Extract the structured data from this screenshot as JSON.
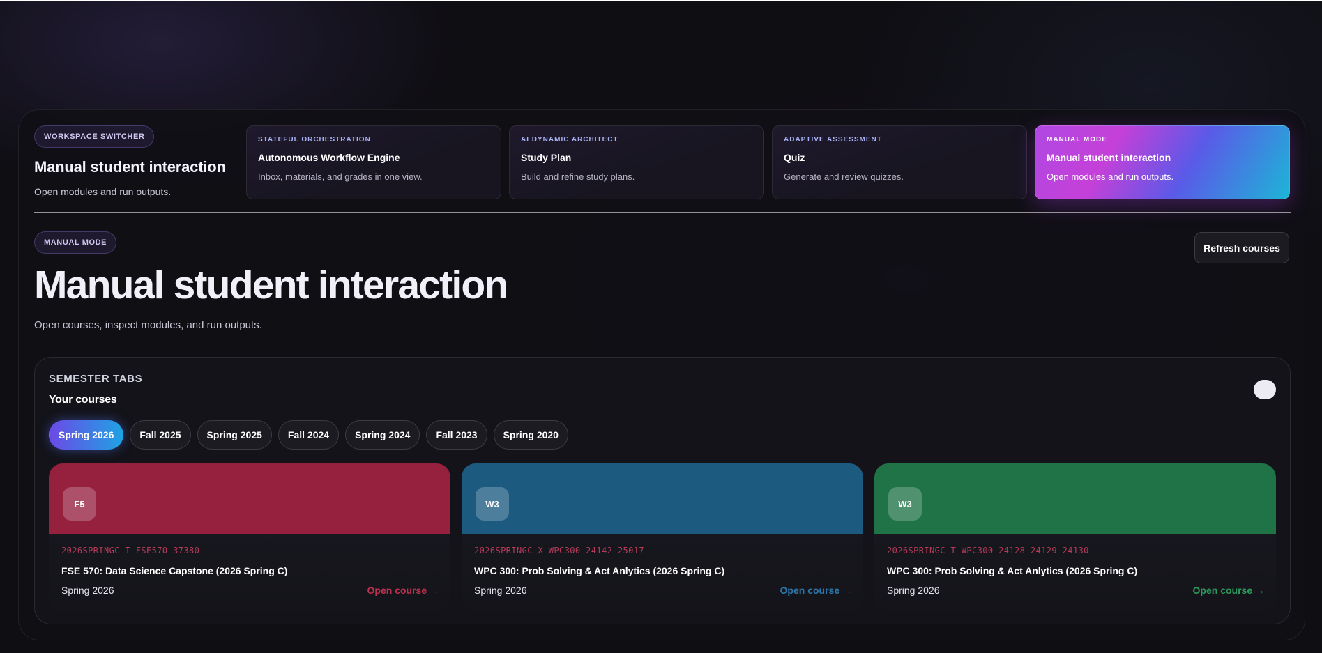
{
  "workspace": {
    "pill": "WORKSPACE SWITCHER",
    "title": "Manual student interaction",
    "subtitle": "Open modules and run outputs.",
    "cards": [
      {
        "eyebrow": "STATEFUL ORCHESTRATION",
        "title": "Autonomous Workflow Engine",
        "desc": "Inbox, materials, and grades in one view."
      },
      {
        "eyebrow": "AI DYNAMIC ARCHITECT",
        "title": "Study Plan",
        "desc": "Build and refine study plans."
      },
      {
        "eyebrow": "ADAPTIVE ASSESSMENT",
        "title": "Quiz",
        "desc": "Generate and review quizzes."
      },
      {
        "eyebrow": "MANUAL MODE",
        "title": "Manual student interaction",
        "desc": "Open modules and run outputs.",
        "active": true
      }
    ]
  },
  "hero": {
    "pill": "MANUAL MODE",
    "title": "Manual student interaction",
    "subtitle": "Open courses, inspect modules, and run outputs.",
    "refresh_label": "Refresh courses"
  },
  "semesters": {
    "eyebrow": "SEMESTER TABS",
    "title": "Your courses",
    "tabs": [
      "Spring 2026",
      "Fall 2025",
      "Spring 2025",
      "Fall 2024",
      "Spring 2024",
      "Fall 2023",
      "Spring 2020"
    ],
    "active_tab": "Spring 2026"
  },
  "courses": [
    {
      "badge": "F5",
      "code": "2026SPRINGC-T-FSE570-37380",
      "name": "FSE 570: Data Science Capstone (2026 Spring C)",
      "term": "Spring 2026",
      "open_label": "Open course →",
      "color": "#95213f"
    },
    {
      "badge": "W3",
      "code": "2026SPRINGC-X-WPC300-24142-25017",
      "name": "WPC 300: Prob Solving & Act Anlytics (2026 Spring C)",
      "term": "Spring 2026",
      "open_label": "Open course →",
      "color": "#1c5a80"
    },
    {
      "badge": "W3",
      "code": "2026SPRINGC-T-WPC300-24128-24129-24130",
      "name": "WPC 300: Prob Solving & Act Anlytics (2026 Spring C)",
      "term": "Spring 2026",
      "open_label": "Open course →",
      "color": "#1f7347"
    }
  ],
  "colors": {
    "accent_gradient_start": "#6b4ae6",
    "accent_gradient_end": "#1fa2e4",
    "background": "#0f0e13"
  }
}
